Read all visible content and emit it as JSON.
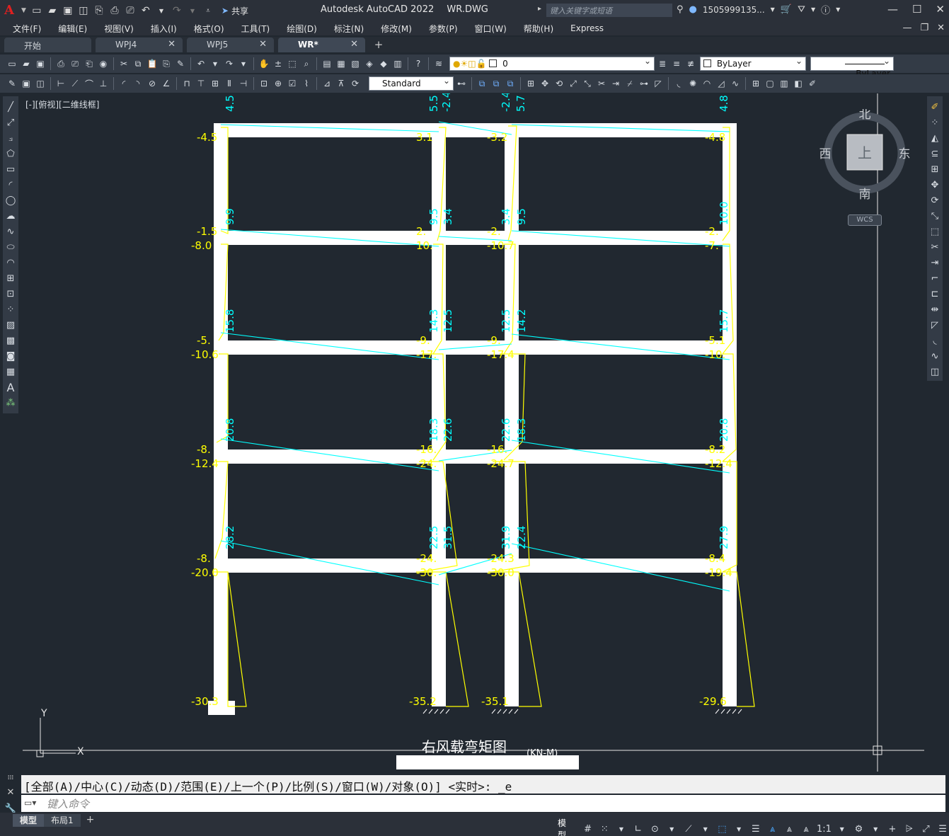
{
  "app": {
    "title": "Autodesk AutoCAD 2022",
    "file": "WR.DWG",
    "logo": "A",
    "share_label": "共享",
    "search_placeholder": "键入关键字或短语",
    "user": "1505999135...",
    "accent": "#e02020"
  },
  "menu": [
    "文件(F)",
    "编辑(E)",
    "视图(V)",
    "插入(I)",
    "格式(O)",
    "工具(T)",
    "绘图(D)",
    "标注(N)",
    "修改(M)",
    "参数(P)",
    "窗口(W)",
    "帮助(H)",
    "Express"
  ],
  "tabs": [
    {
      "label": "开始",
      "closable": false
    },
    {
      "label": "WPJ4",
      "closable": true
    },
    {
      "label": "WPJ5",
      "closable": true
    },
    {
      "label": "WR*",
      "closable": true,
      "active": true
    }
  ],
  "toolbar": {
    "layer_value": "0",
    "color_value": "ByLayer",
    "linetype_value": "ByLayer",
    "textstyle_value": "Standard"
  },
  "viewport": {
    "label": "[-][俯视][二维线框]",
    "viewcube": {
      "north": "北",
      "south": "南",
      "east": "东",
      "west": "西",
      "top": "上",
      "wcs": "WCS"
    }
  },
  "drawing": {
    "title": "右风载弯矩图",
    "unit": "(KN-M)",
    "axis_y": "Y",
    "axis_x": "X",
    "colors": {
      "frame": "#ffffff",
      "column_moment": "#ffff00",
      "beam_moment": "#00ffff"
    },
    "top_labels": [
      {
        "col": "A",
        "text": "4.5"
      },
      {
        "col": "B",
        "text": "5.5"
      },
      {
        "col": "B",
        "text": "-2.4"
      },
      {
        "col": "C",
        "text": "-2.4"
      },
      {
        "col": "C",
        "text": "5.7"
      },
      {
        "col": "D",
        "text": "4.8"
      }
    ],
    "column_left_labels": [
      {
        "col": "A",
        "texts": [
          "-4.5"
        ]
      },
      {
        "col": "A",
        "texts": [
          "-1.5",
          "-8.0"
        ]
      },
      {
        "col": "A",
        "texts": [
          "-5.",
          "-10.6"
        ]
      },
      {
        "col": "A",
        "texts": [
          "-8.",
          "-12.4"
        ]
      },
      {
        "col": "A",
        "texts": [
          "-8.",
          "-20.0"
        ]
      },
      {
        "col": "A",
        "texts": [
          "-30.3"
        ]
      }
    ],
    "column_b_labels": [
      [
        "3.1"
      ],
      [
        "2.",
        "10."
      ],
      [
        "-9.",
        "-17."
      ],
      [
        "-16.",
        "-24."
      ],
      [
        "-24.",
        "-30."
      ],
      [
        "-35.2"
      ]
    ],
    "column_c_labels": [
      [
        "-3.2"
      ],
      [
        "-2.",
        "-10.7"
      ],
      [
        "-9.",
        "-17.4"
      ],
      [
        "-16.",
        "-24.7"
      ],
      [
        "-24.3",
        "-30.0"
      ],
      [
        "-35.1"
      ]
    ],
    "column_d_labels": [
      [
        "-4.8"
      ],
      [
        "-2.",
        "-7."
      ],
      [
        "-5.1",
        "-10."
      ],
      [
        "-8.2",
        "-12.4"
      ],
      [
        "-8.4",
        "-19.4"
      ],
      [
        "-29.6"
      ]
    ],
    "beam_labels": {
      "floor1": [
        "28.2",
        "22.5",
        "31.5",
        "31.9",
        "22.4",
        "27.9"
      ],
      "floor2": [
        "20.8",
        "18.3",
        "22.6",
        "22.6",
        "18.3",
        "20.8"
      ],
      "floor3": [
        "15.8",
        "14.3",
        "12.5",
        "12.5",
        "14.2",
        "15.7"
      ],
      "floor4": [
        "9.9",
        "9.5",
        "3.4",
        "3.4",
        "9.5",
        "10.0"
      ]
    }
  },
  "command": {
    "history": "[全部(A)/中心(C)/动态(D)/范围(E)/上一个(P)/比例(S)/窗口(W)/对象(O)] <实时>: _e",
    "placeholder": "键入命令"
  },
  "layout_tabs": [
    "模型",
    "布局1"
  ],
  "status": {
    "model": "模型",
    "scale": "1:1"
  }
}
